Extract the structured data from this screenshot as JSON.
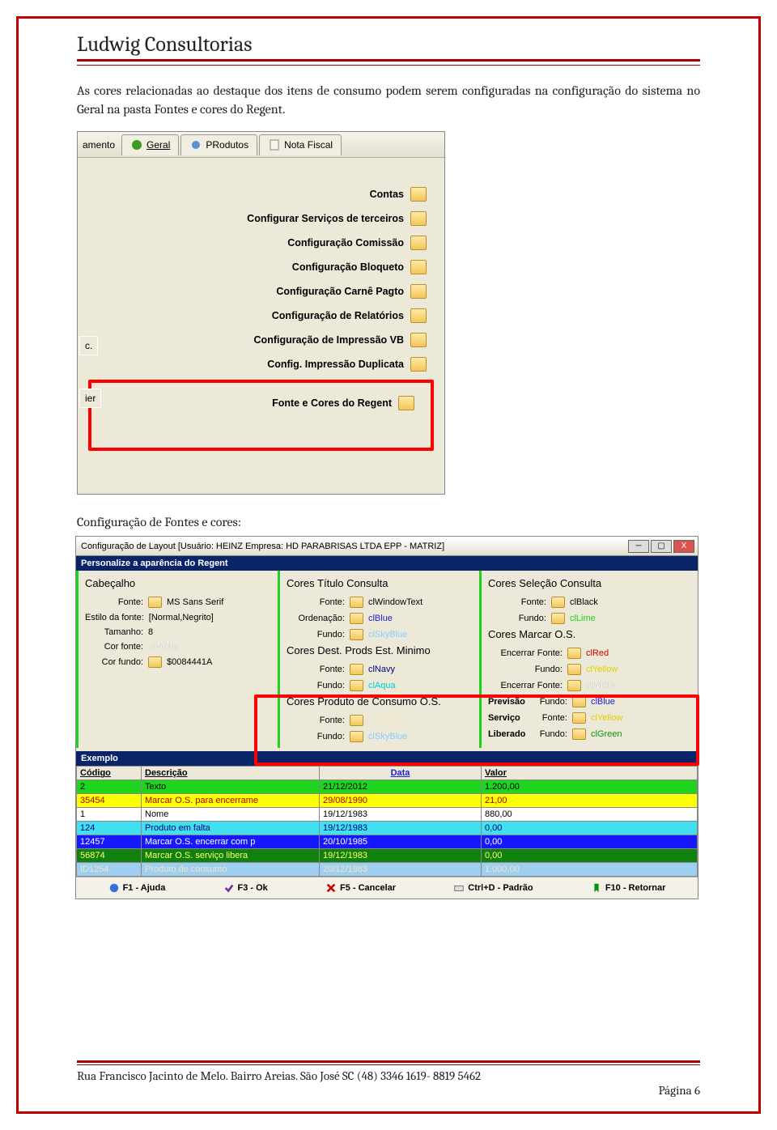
{
  "header": {
    "company": "Ludwig Consultorias"
  },
  "intro_text": "As cores relacionadas ao destaque dos itens de consumo podem serem configuradas na configuração do sistema no Geral na pasta Fontes e cores do Regent.",
  "screenshot1": {
    "tabs": {
      "frag": "amento",
      "geral": "Geral",
      "produtos": "PRodutos",
      "nota_fiscal": "Nota Fiscal"
    },
    "side_frag1": "c.",
    "side_frag2": "ier",
    "items": [
      "Contas",
      "Configurar Serviços de terceiros",
      "Configuração Comissão",
      "Configuração Bloqueto",
      "Configuração Carnê Pagto",
      "Configuração de Relatórios",
      "Configuração de Impressão VB",
      "Config. Impressão Duplicata"
    ],
    "highlighted_item": "Fonte e Cores do Regent"
  },
  "subhead": "Configuração de Fontes e cores:",
  "screenshot2": {
    "title": "Configuração de Layout [Usuário: HEINZ  Empresa: HD PARABRISAS LTDA EPP - MATRIZ]",
    "legend": "Personalize a aparência do Regent",
    "cabecalho": {
      "group": "Cabeçalho",
      "fonte_lbl": "Fonte:",
      "fonte_val": "MS Sans Serif",
      "estilo_lbl": "Estilo da fonte:",
      "estilo_val": "[Normal,Negrito]",
      "tamanho_lbl": "Tamanho:",
      "tamanho_val": "8",
      "cor_fonte_lbl": "Cor fonte:",
      "cor_fonte_val": "clWhite",
      "cor_fundo_lbl": "Cor fundo:",
      "cor_fundo_val": "$0084441A"
    },
    "cores_titulo": {
      "group": "Cores Título Consulta",
      "fonte_lbl": "Fonte:",
      "fonte_val": "clWindowText",
      "ord_lbl": "Ordenação:",
      "ord_val": "clBlue",
      "fundo_lbl": "Fundo:",
      "fundo_val": "clSkyBlue"
    },
    "cores_dest": {
      "group": "Cores Dest. Prods Est. Minimo",
      "fonte_lbl": "Fonte:",
      "fonte_val": "clNavy",
      "fundo_lbl": "Fundo:",
      "fundo_val": "clAqua"
    },
    "cores_consumo": {
      "group": "Cores Produto de Consumo O.S.",
      "fonte_lbl": "Fonte:",
      "fonte_val": "clCream",
      "fundo_lbl": "Fundo:",
      "fundo_val": "clSkyBlue"
    },
    "cores_selecao": {
      "group": "Cores Seleção Consulta",
      "fonte_lbl": "Fonte:",
      "fonte_val": "clBlack",
      "fundo_lbl": "Fundo:",
      "fundo_val": "clLime"
    },
    "cores_os": {
      "group": "Cores Marcar O.S.",
      "enc_fonte_lbl": "Encerrar  Fonte:",
      "enc_fonte_val": "clRed",
      "enc_fundo_lbl": "Fundo:",
      "enc_fundo_val": "clYellow",
      "encp_fonte_lbl": "Encerrar  Fonte:",
      "encp_fonte_val": "clWhite",
      "prev_lbl": "Previsão",
      "prev_fundo_lbl": "Fundo:",
      "prev_fundo_val": "clBlue",
      "serv_lbl": "Serviço",
      "serv_fonte_lbl": "Fonte:",
      "serv_fonte_val": "clYellow",
      "lib_lbl": "Liberado",
      "lib_fundo_lbl": "Fundo:",
      "lib_fundo_val": "clGreen"
    },
    "exemplo_label": "Exemplo",
    "table": {
      "headers": [
        "Código",
        "Descrição",
        "Data",
        "Valor"
      ],
      "rows": [
        {
          "style": "lime",
          "cells": [
            "2",
            "Texto",
            "21/12/2012",
            "1.200,00"
          ]
        },
        {
          "style": "yellow",
          "cells": [
            "35454",
            "Marcar O.S. para encerrame",
            "29/08/1990",
            "21,00"
          ]
        },
        {
          "style": "white",
          "cells": [
            "1",
            "Nome",
            "19/12/1983",
            "880,00"
          ]
        },
        {
          "style": "aqua",
          "cells": [
            "124",
            "Produto em falta",
            "19/12/1983",
            "0,00"
          ]
        },
        {
          "style": "blue",
          "cells": [
            "12457",
            "Marcar O.S. encerrar com p",
            "20/10/1985",
            "0,00"
          ]
        },
        {
          "style": "green",
          "cells": [
            "56874",
            "Marcar O.S. serviço libera",
            "19/12/1983",
            "0,00"
          ]
        },
        {
          "style": "sky",
          "cells": [
            "ID1254",
            "Produto de consumo",
            "20/12/1983",
            "1.000,00"
          ]
        }
      ]
    },
    "fkeys": {
      "f1": "F1 - Ajuda",
      "f3": "F3 - Ok",
      "f5": "F5 - Cancelar",
      "ctrld": "Ctrl+D - Padrão",
      "f10": "F10 - Retornar"
    }
  },
  "footer": {
    "address": "Rua Francisco Jacinto de Melo. Bairro Areias. São José SC (48) 3346 1619- 8819 5462",
    "page": "Página 6"
  }
}
